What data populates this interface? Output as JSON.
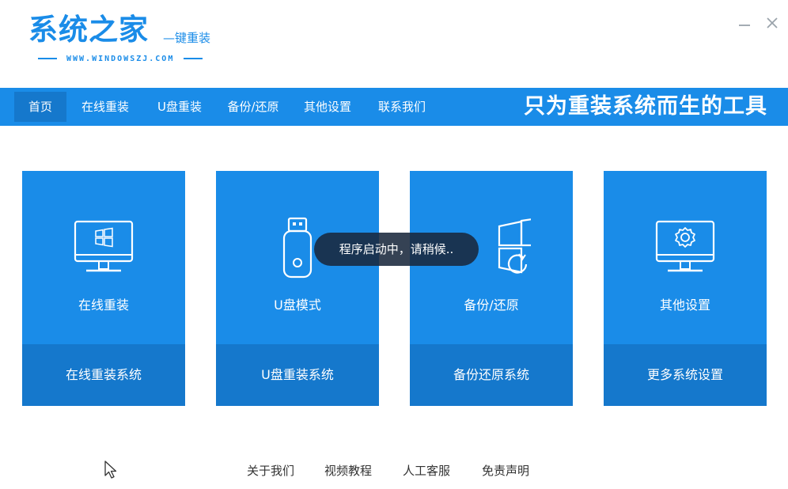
{
  "app": {
    "title": "系统之家",
    "subtitle": "—键重装",
    "url": "WWW.WINDOWSZJ.COM"
  },
  "window": {
    "minimize_icon": "minimize-icon",
    "close_icon": "close-icon"
  },
  "nav": {
    "items": [
      {
        "label": "首页",
        "active": true
      },
      {
        "label": "在线重装",
        "active": false
      },
      {
        "label": "U盘重装",
        "active": false
      },
      {
        "label": "备份/还原",
        "active": false
      },
      {
        "label": "其他设置",
        "active": false
      },
      {
        "label": "联系我们",
        "active": false
      }
    ],
    "slogan": "只为重装系统而生的工具"
  },
  "cards": [
    {
      "icon": "monitor-windows-icon",
      "label": "在线重装",
      "action": "在线重装系统"
    },
    {
      "icon": "usb-drive-icon",
      "label": "U盘模式",
      "action": "U盘重装系统"
    },
    {
      "icon": "windows-restore-icon",
      "label": "备份/还原",
      "action": "备份还原系统"
    },
    {
      "icon": "monitor-gear-icon",
      "label": "其他设置",
      "action": "更多系统设置"
    }
  ],
  "toast": {
    "text": "程序启动中，请稍候.."
  },
  "footer": {
    "links": [
      "关于我们",
      "视频教程",
      "人工客服",
      "免责声明"
    ]
  },
  "colors": {
    "primary": "#1a8ce8",
    "primary_dark": "#1578cc",
    "toast_bg": "#19283c",
    "background": "#ffffff"
  }
}
